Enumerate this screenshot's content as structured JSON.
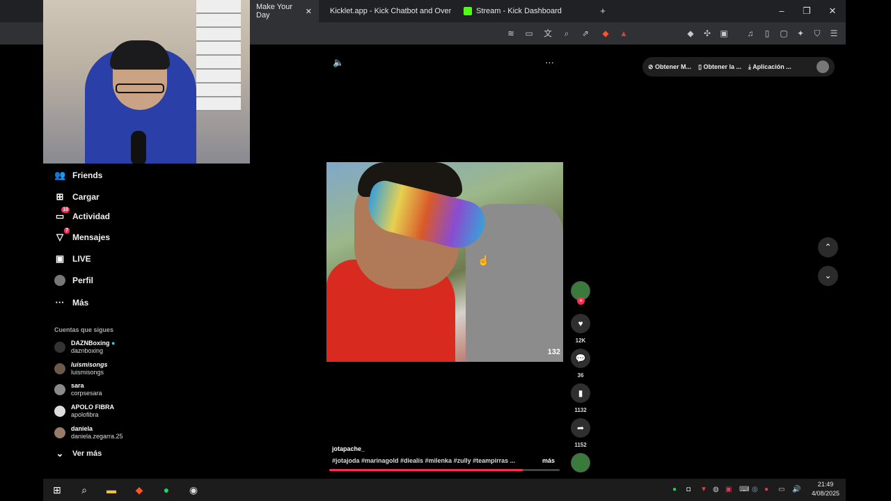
{
  "browser": {
    "tabs": [
      {
        "label": "Make Your Day",
        "active": true
      },
      {
        "label": "Kicklet.app - Kick Chatbot and Overla",
        "active": false
      },
      {
        "label": "Stream - Kick Dashboard",
        "active": false
      }
    ],
    "new_tab": "+",
    "window": {
      "minimize": "–",
      "restore": "❐",
      "close": "✕"
    }
  },
  "sidebar": {
    "items": [
      {
        "label": "Friends",
        "icon": "friends-icon",
        "glyph": "👥"
      },
      {
        "label": "Cargar",
        "icon": "upload-icon",
        "glyph": "⊞"
      },
      {
        "label": "Actividad",
        "icon": "activity-icon",
        "glyph": "▭",
        "badge": "10"
      },
      {
        "label": "Mensajes",
        "icon": "messages-icon",
        "glyph": "▽",
        "badge": "7"
      },
      {
        "label": "LIVE",
        "icon": "live-icon",
        "glyph": "▣"
      },
      {
        "label": "Perfil",
        "icon": "profile-avatar"
      },
      {
        "label": "Más",
        "icon": "more-icon",
        "glyph": "···"
      }
    ],
    "following_title": "Cuentas que sigues",
    "following": [
      {
        "name": "DAZNBoxing",
        "handle": "daznboxing",
        "verified": true
      },
      {
        "name": "luismisongs",
        "handle": "luismisongs"
      },
      {
        "name": "sara",
        "handle": "corpsesara"
      },
      {
        "name": "APOLO FIBRA",
        "handle": "apolofibra"
      },
      {
        "name": "daniela",
        "handle": "daniela.zegarra.25"
      }
    ],
    "see_more": "Ver más"
  },
  "video": {
    "watermark": "132",
    "author": "jotapache_",
    "tags": "#jotajoda #marinagold #diealis #milenka #zully #teampirras ...",
    "more": "más",
    "progress": 0.84
  },
  "actions": {
    "likes": "12K",
    "comments": "36",
    "saves": "1132",
    "shares": "1152"
  },
  "top_pill": {
    "items": [
      "Obtener M...",
      "Obtener la ...",
      "Aplicación ..."
    ]
  },
  "taskbar": {
    "time": "21:49",
    "date": "4/08/2025"
  },
  "colors": {
    "accent": "#fe2c55",
    "background": "#000000"
  }
}
